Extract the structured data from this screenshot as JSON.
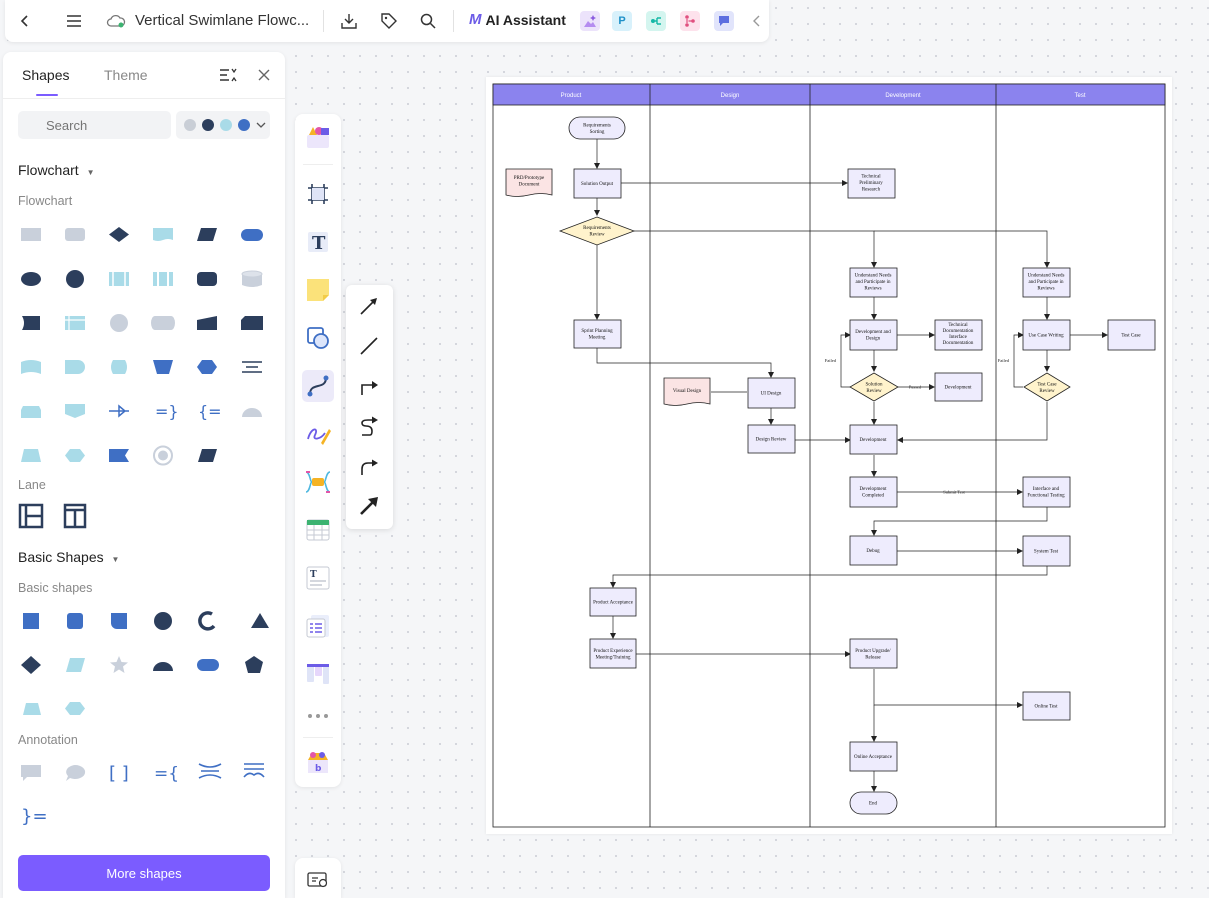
{
  "topbar": {
    "title": "Vertical Swimlane Flowc...",
    "ai_label": "AI Assistant",
    "ai_logo": "M",
    "apps": [
      "P"
    ]
  },
  "panel": {
    "tabs": [
      "Shapes",
      "Theme"
    ],
    "search_placeholder": "Search",
    "colors": [
      "#c9ced6",
      "#2c3e5c",
      "#a9dbe8",
      "#3f6fc4"
    ],
    "sections": {
      "flowchart_title": "Flowchart",
      "flowchart_sub": "Flowchart",
      "lane_sub": "Lane",
      "basic_title": "Basic Shapes",
      "basic_sub": "Basic shapes",
      "annotation_sub": "Annotation"
    },
    "more_shapes": "More shapes"
  },
  "diagram": {
    "lanes": [
      "Product",
      "Design",
      "Development",
      "Test"
    ],
    "nodes": {
      "req_sorting": [
        "Requirements",
        "Sorting"
      ],
      "prd": [
        "PRD/Prototype",
        "Document"
      ],
      "solution_output": [
        "Solution Output"
      ],
      "tech_research": [
        "Technical",
        "Preliminary",
        "Research"
      ],
      "req_review": [
        "Requirements",
        "Review"
      ],
      "dev_understand": [
        "Understand Needs",
        "and Participate in",
        "Reviews"
      ],
      "test_understand": [
        "Understand Needs",
        "and Participate in",
        "Reviews"
      ],
      "sprint": [
        "Sprint Planning",
        "Meeting"
      ],
      "dev_design": [
        "Development and",
        "Design"
      ],
      "tech_doc": [
        "Technical",
        "Documentation",
        "Interface",
        "Documentation"
      ],
      "use_case_writing": [
        "Use Case Writing"
      ],
      "test_case": [
        "Test Case"
      ],
      "visual_design": [
        "Visual Design"
      ],
      "ui_design": [
        "UI Design"
      ],
      "solution_review": [
        "Solution",
        "Review"
      ],
      "development_out": [
        "Development"
      ],
      "test_case_review": [
        "Test Case",
        "Review"
      ],
      "design_review": [
        "Design Review"
      ],
      "development": [
        "Development"
      ],
      "dev_completed": [
        "Development",
        "Completed"
      ],
      "interface_testing": [
        "Interface and",
        "Functional Testing"
      ],
      "debug": [
        "Debug"
      ],
      "system_test": [
        "System Test"
      ],
      "product_acceptance": [
        "Product Acceptance"
      ],
      "product_experience": [
        "Product Experience",
        "Meeting/Training"
      ],
      "product_upgrade": [
        "Product Upgrade/",
        "Release"
      ],
      "online_test": [
        "Online Test"
      ],
      "online_acceptance": [
        "Online Acceptance"
      ],
      "end": [
        "End"
      ]
    },
    "edge_labels": {
      "failed1": "Failed",
      "passed": "Passed",
      "failed2": "Failed",
      "submit_test": "Submit Test"
    }
  }
}
